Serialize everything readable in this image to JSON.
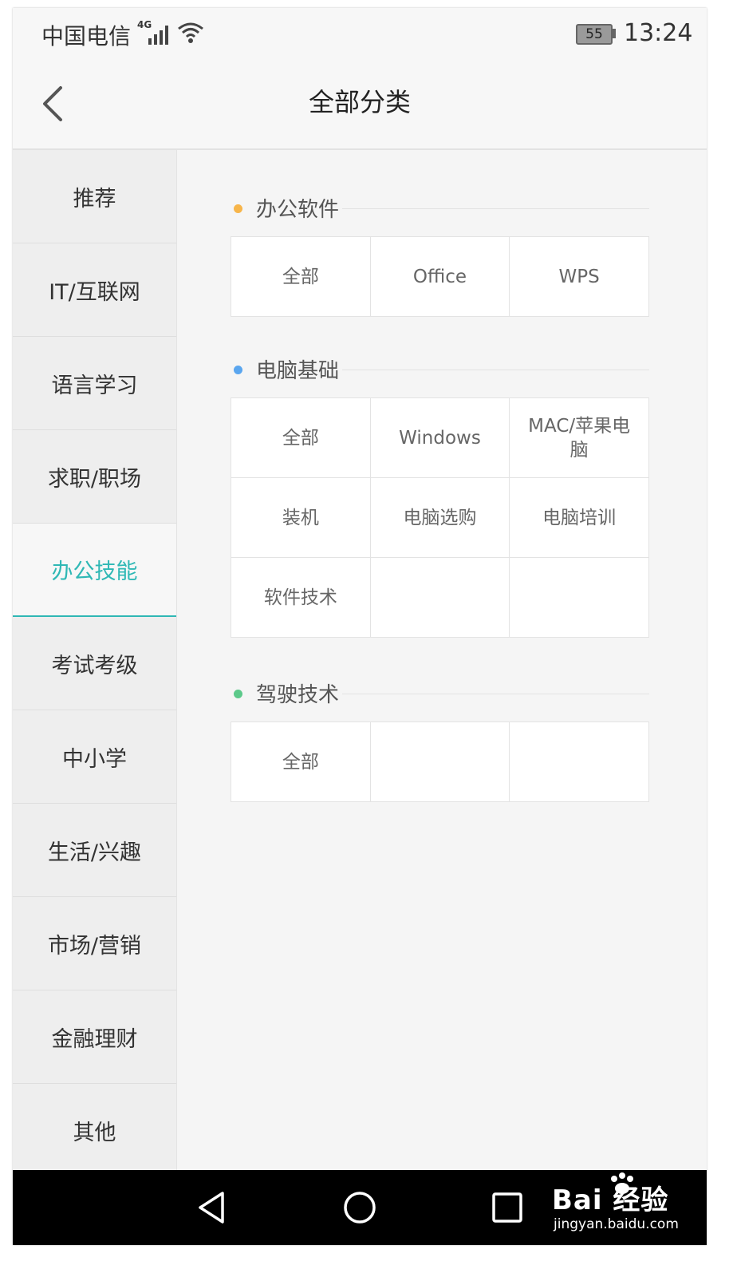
{
  "status_bar": {
    "carrier": "中国电信",
    "network_badge": "4G",
    "battery": "55",
    "time": "13:24",
    "icons": [
      "signal-icon",
      "wifi-icon",
      "battery-icon"
    ]
  },
  "nav": {
    "title": "全部分类",
    "back_icon": "chevron-left-icon"
  },
  "sidebar": {
    "active_index": 4,
    "accent_color": "#2fb8b5",
    "items": [
      {
        "label": "推荐"
      },
      {
        "label": "IT/互联网"
      },
      {
        "label": "语言学习"
      },
      {
        "label": "求职/职场"
      },
      {
        "label": "办公技能"
      },
      {
        "label": "考试考级"
      },
      {
        "label": "中小学"
      },
      {
        "label": "生活/兴趣"
      },
      {
        "label": "市场/营销"
      },
      {
        "label": "金融理财"
      },
      {
        "label": "其他"
      }
    ]
  },
  "sections": [
    {
      "title": "办公软件",
      "dot_color": "#f7b54a",
      "cells": [
        {
          "label": "全部"
        },
        {
          "label": "Office"
        },
        {
          "label": "WPS"
        }
      ]
    },
    {
      "title": "电脑基础",
      "dot_color": "#5aa6ef",
      "cells": [
        {
          "label": "全部"
        },
        {
          "label": "Windows"
        },
        {
          "label": "MAC/苹果电脑"
        },
        {
          "label": "装机"
        },
        {
          "label": "电脑选购"
        },
        {
          "label": "电脑培训"
        },
        {
          "label": "软件技术"
        },
        {
          "label": ""
        },
        {
          "label": ""
        }
      ]
    },
    {
      "title": "驾驶技术",
      "dot_color": "#5cc98a",
      "cells": [
        {
          "label": "全部"
        },
        {
          "label": ""
        },
        {
          "label": ""
        }
      ]
    }
  ],
  "system_nav": {
    "icons": [
      "back-triangle-icon",
      "home-circle-icon",
      "recent-square-icon"
    ]
  },
  "watermark": {
    "brand": "Bai 经验",
    "url": "jingyan.baidu.com"
  }
}
